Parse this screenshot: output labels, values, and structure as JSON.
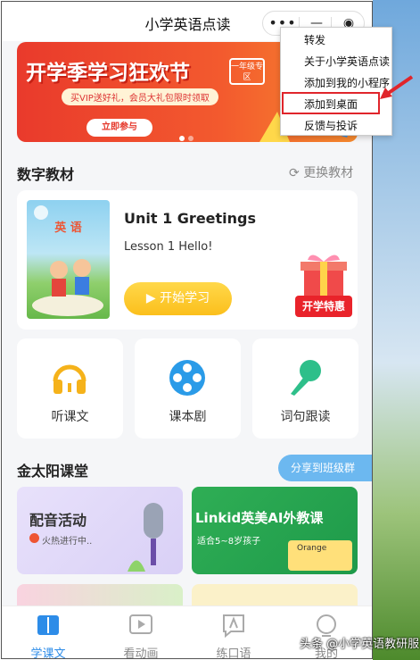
{
  "header": {
    "title": "小学英语点读",
    "more_icon": "•••",
    "minimize_icon": "—",
    "close_icon": "◉"
  },
  "banner": {
    "title": "开学季学习狂欢节",
    "tag": "一年级专区",
    "subtitle": "买VIP送好礼，会员大礼包限时领取",
    "cta": "立即参与"
  },
  "textbook_section": {
    "title": "数字教材",
    "switch_label": "更换教材"
  },
  "textbook": {
    "cover_label": "英 语",
    "unit_title": "Unit 1 Greetings",
    "lesson": "Lesson 1 Hello!",
    "start_label": "开始学习",
    "promo_label": "开学特惠"
  },
  "tiles": [
    {
      "label": "听课文",
      "icon": "headphones-icon"
    },
    {
      "label": "课本剧",
      "icon": "film-reel-icon"
    },
    {
      "label": "词句跟读",
      "icon": "microphone-icon"
    }
  ],
  "class_section": {
    "title": "金太阳课堂",
    "share_label": "分享到班级群"
  },
  "cards": {
    "dub_title": "配音活动",
    "dub_status": "火热进行中..",
    "ai_title": "Linkid英美AI外教课",
    "ai_sub": "适合5~8岁孩子",
    "ai_board_text": "Orange"
  },
  "nav": [
    {
      "label": "学课文",
      "icon": "book-icon",
      "active": true
    },
    {
      "label": "看动画",
      "icon": "play-icon",
      "active": false
    },
    {
      "label": "练口语",
      "icon": "speak-icon",
      "active": false
    },
    {
      "label": "我的",
      "icon": "user-icon",
      "active": false
    }
  ],
  "menu": {
    "items": [
      "转发",
      "关于小学英语点读",
      "添加到我的小程序",
      "添加到桌面",
      "反馈与投诉"
    ],
    "highlighted_index": 3
  },
  "watermark": "头条 @小学英语教研服务",
  "colors": {
    "accent": "#2d8ce8",
    "banner_red": "#e93a2c",
    "start_yellow": "#fbbf1c",
    "highlight_red": "#e0252b"
  }
}
